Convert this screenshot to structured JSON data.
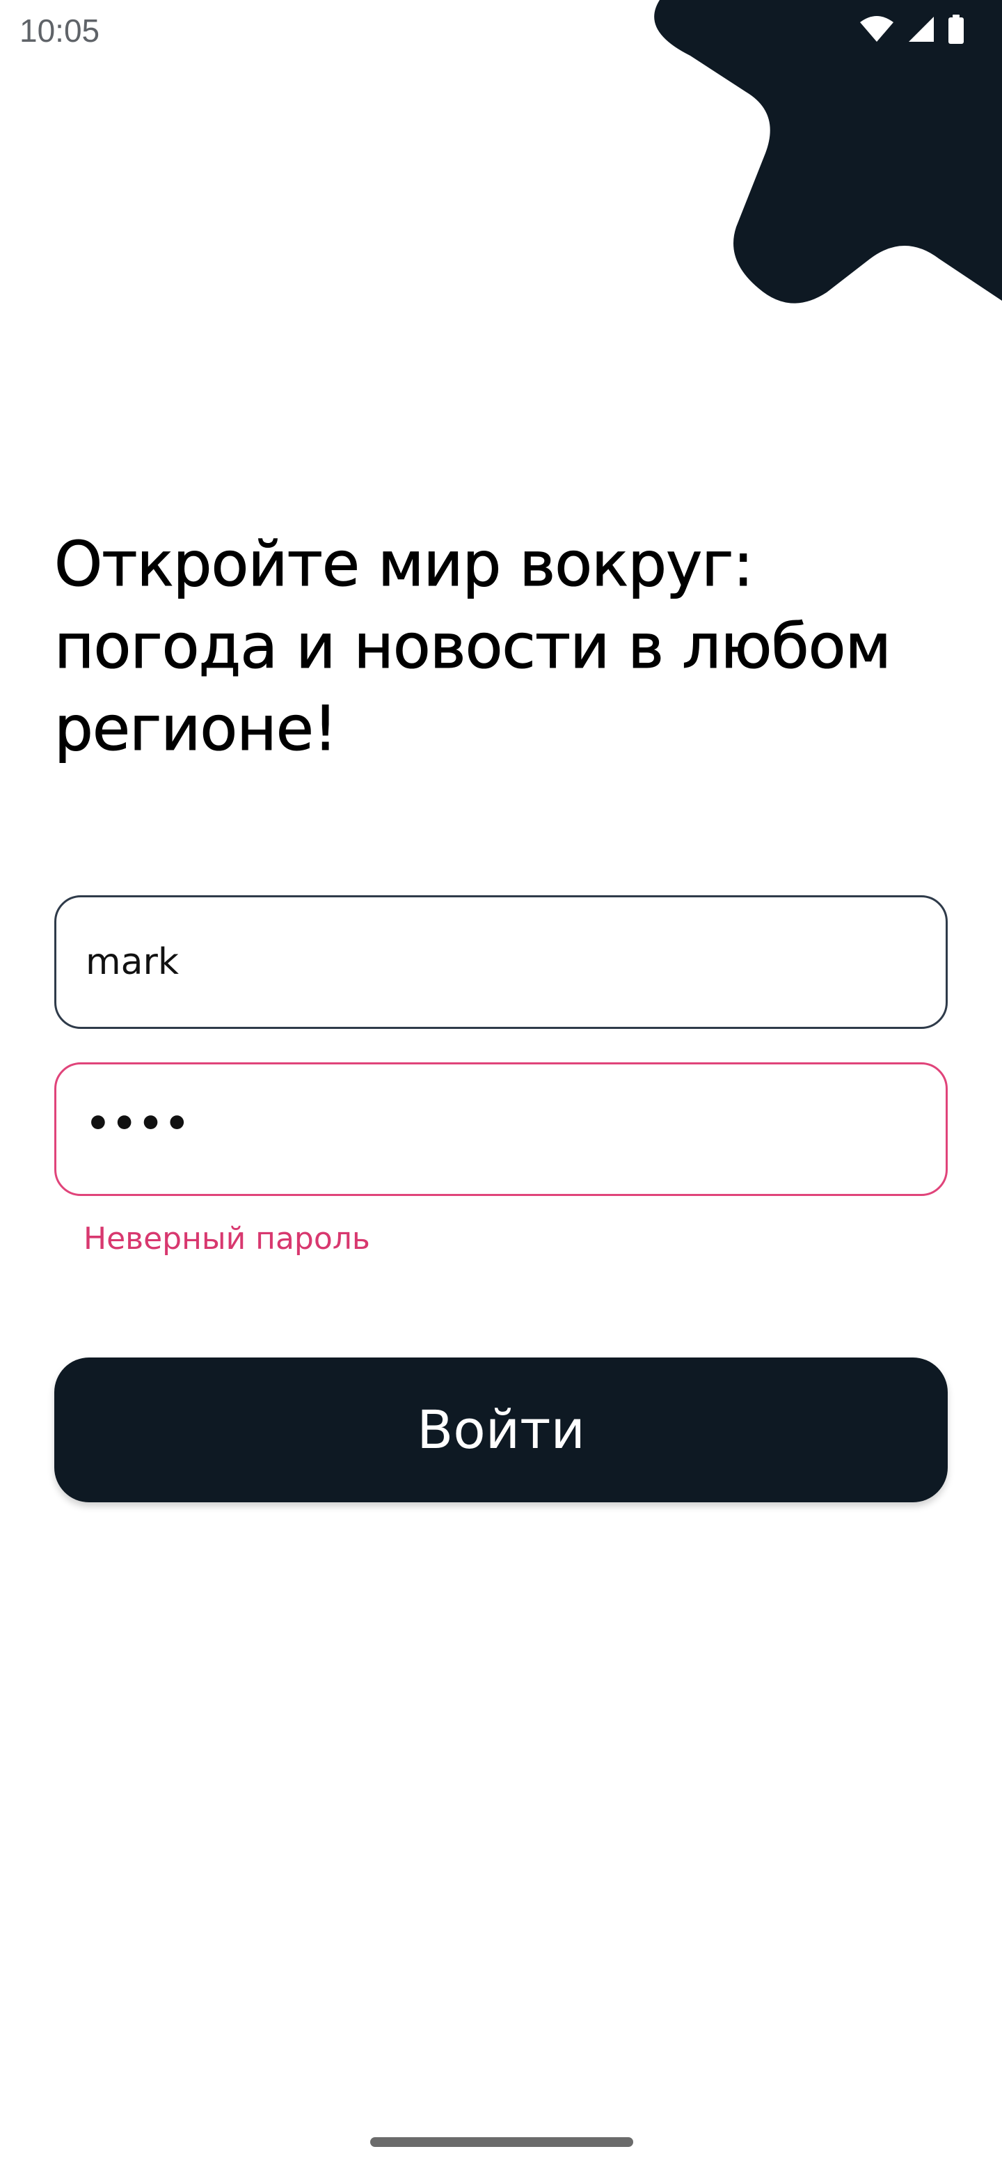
{
  "status_bar": {
    "time": "10:05",
    "icons": [
      "wifi-icon",
      "cellular-signal-icon",
      "battery-icon"
    ]
  },
  "colors": {
    "accent_dark": "#0e1923",
    "error": "#d8386f",
    "field_border": "#2f3b4a"
  },
  "headline": {
    "line1": "Откройте мир вокруг:",
    "line2": "погода и новости в любом",
    "line3": "регионе!"
  },
  "form": {
    "login_value": "mark",
    "password_value": "••••",
    "error_message": "Неверный пароль",
    "submit_label": "Войти"
  }
}
